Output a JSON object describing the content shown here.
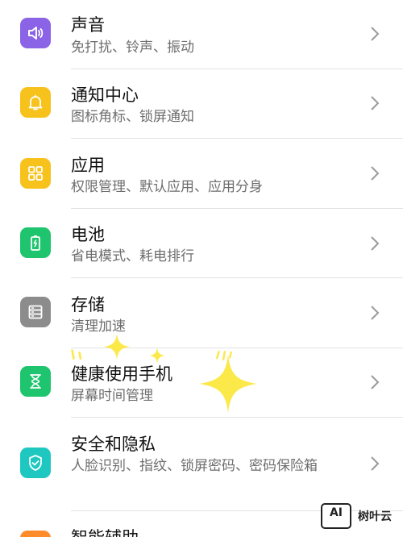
{
  "settings": {
    "items": [
      {
        "title": "声音",
        "subtitle": "免打扰、铃声、振动",
        "icon": "speaker-icon",
        "color": "#8a63e6"
      },
      {
        "title": "通知中心",
        "subtitle": "图标角标、锁屏通知",
        "icon": "bell-icon",
        "color": "#f7c21c"
      },
      {
        "title": "应用",
        "subtitle": "权限管理、默认应用、应用分身",
        "icon": "apps-grid-icon",
        "color": "#f7c21c"
      },
      {
        "title": "电池",
        "subtitle": "省电模式、耗电排行",
        "icon": "battery-icon",
        "color": "#1fc46e"
      },
      {
        "title": "存储",
        "subtitle": "清理加速",
        "icon": "storage-icon",
        "color": "#8c8c8c"
      },
      {
        "title": "健康使用手机",
        "subtitle": "屏幕时间管理",
        "icon": "hourglass-icon",
        "color": "#1fc46e"
      },
      {
        "title": "安全和隐私",
        "subtitle": "人脸识别、指纹、锁屏密码、密码保险箱",
        "icon": "shield-icon",
        "color": "#1ec8c0"
      },
      {
        "title": "智能辅助",
        "subtitle": "",
        "icon": "assist-icon",
        "color": "#ff8c2a"
      }
    ]
  },
  "watermark": {
    "logo_text": "AI",
    "brand": "树叶云"
  }
}
